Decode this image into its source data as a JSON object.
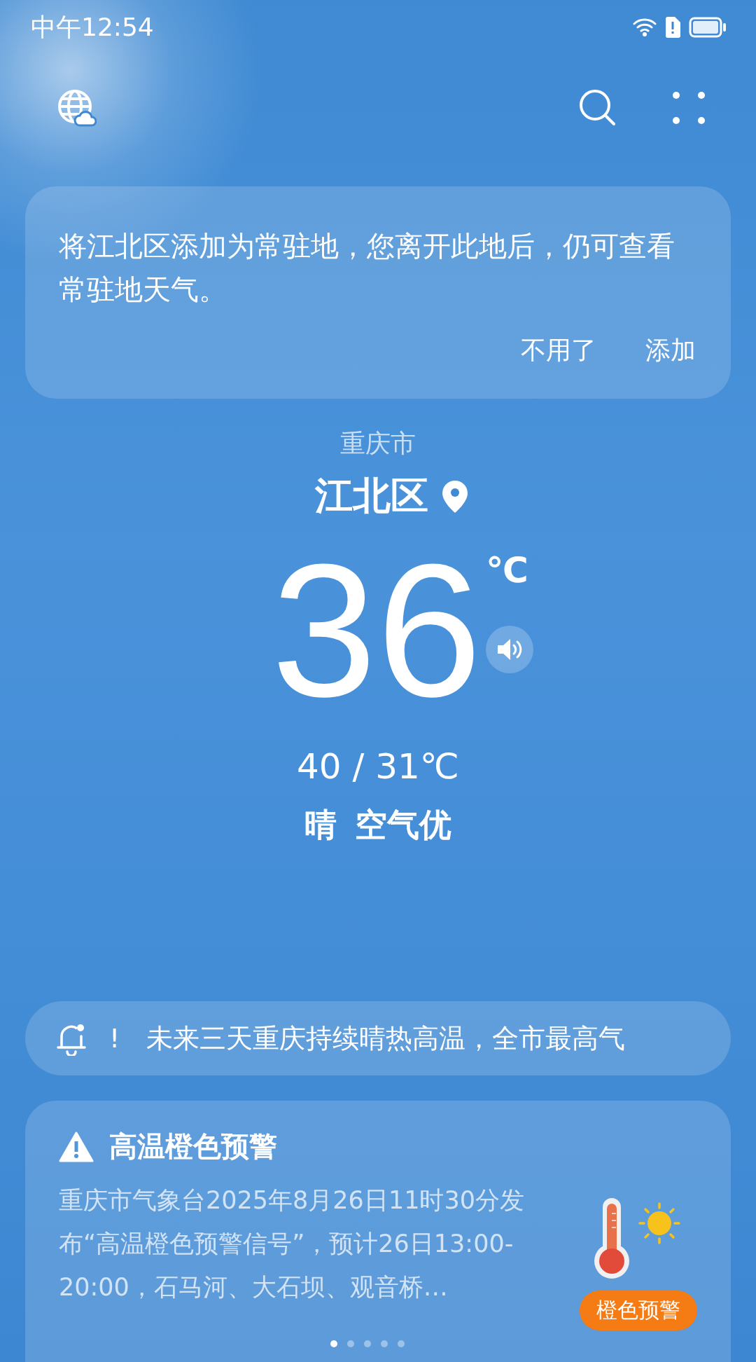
{
  "status_bar": {
    "time": "中午12:54"
  },
  "prompt_card": {
    "message": "将江北区添加为常驻地，您离开此地后，仍可查看常驻地天气。",
    "actions": [
      {
        "label": "不用了"
      },
      {
        "label": "添加"
      }
    ]
  },
  "location": {
    "city": "重庆市",
    "district": "江北区"
  },
  "current": {
    "temperature": "36",
    "unit": "℃",
    "range": "40 / 31℃",
    "condition": "晴",
    "air": "空气优"
  },
  "notice": {
    "prefix": "!",
    "text": "未来三天重庆持续晴热高温，全市最高气"
  },
  "warning": {
    "title": "高温橙色预警",
    "body": "重庆市气象台2025年8月26日11时30分发布“高温橙色预警信号”，预计26日13:00-20:00，石马河、大石坝、观音桥…",
    "badge": "橙色预警"
  },
  "pager": [
    {
      "selected": true
    },
    {
      "selected": false
    },
    {
      "selected": false
    },
    {
      "selected": false
    },
    {
      "selected": false
    }
  ]
}
